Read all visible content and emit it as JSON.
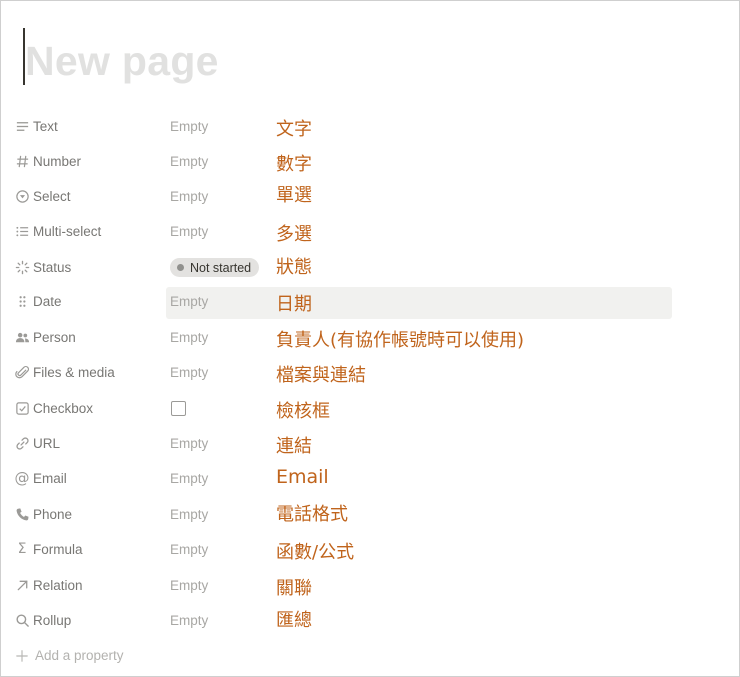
{
  "page": {
    "title_placeholder": "New page"
  },
  "properties": [
    {
      "name": "Text",
      "icon": "text-lines-icon",
      "value": "Empty",
      "note": "文字"
    },
    {
      "name": "Number",
      "icon": "hash-icon",
      "value": "Empty",
      "note": "數字"
    },
    {
      "name": "Select",
      "icon": "select-circle-icon",
      "value": "Empty",
      "note": "單選"
    },
    {
      "name": "Multi-select",
      "icon": "list-icon",
      "value": "Empty",
      "note": "多選"
    },
    {
      "name": "Status",
      "icon": "status-spinner-icon",
      "value": "Not started",
      "note": "狀態"
    },
    {
      "name": "Date",
      "icon": "drag-handle-icon",
      "value": "Empty",
      "note": "日期"
    },
    {
      "name": "Person",
      "icon": "people-icon",
      "value": "Empty",
      "note": "負責人(有協作帳號時可以使用)"
    },
    {
      "name": "Files & media",
      "icon": "paperclip-icon",
      "value": "Empty",
      "note": "檔案與連結"
    },
    {
      "name": "Checkbox",
      "icon": "checkbox-icon",
      "value": "",
      "note": "檢核框"
    },
    {
      "name": "URL",
      "icon": "link-icon",
      "value": "Empty",
      "note": "連結"
    },
    {
      "name": "Email",
      "icon": "at-icon",
      "value": "Empty",
      "note": "Email"
    },
    {
      "name": "Phone",
      "icon": "phone-icon",
      "value": "Empty",
      "note": "電話格式"
    },
    {
      "name": "Formula",
      "icon": "sigma-icon",
      "value": "Empty",
      "note": "函數/公式"
    },
    {
      "name": "Relation",
      "icon": "arrow-up-right-icon",
      "value": "Empty",
      "note": "關聯"
    },
    {
      "name": "Rollup",
      "icon": "search-icon",
      "value": "Empty",
      "note": "匯總"
    }
  ],
  "add_property": {
    "label": "Add a property",
    "icon": "plus-icon"
  },
  "colors": {
    "note": "#c0641c",
    "label": "#787774",
    "empty": "#a8a7a4",
    "title_placeholder": "#e1e1e0"
  }
}
